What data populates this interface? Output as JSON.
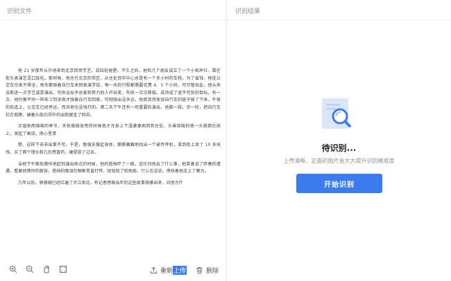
{
  "left_panel": {
    "title": "识别文件",
    "document": {
      "paragraphs": [
        "他 21 岁那年从外地来到北京拜师学艺，却四处碰壁。不久之后，他和几个朋友成立了一个小相声社，靠在街头表演艺混口饭吃。那时候，他住在北京的郊区，从住处到市中心总是有一个多小时的车程。为了省钱，他连公交车也舍不得坐，每天都骑着自行车来回表演学徒。每一天的行程都需要花费 4、5 个小时。可尽管如此，他从来没断进一次学艺或是演出。可命运似乎总爱和努力的人开玩笑，失败一次次降临，成功成了遥不可及的目标。有一次，他仍像平时一样练习到深夜才骑着自行车回家。可刚骑出没多远，他就突然发现自行车的链子掉了下来。午夜的街道上，公交车已经停运，而且他也没钱打的。第二天下午还有一场重要的演出，他脚一踩，牙一咬，把自行车扛在肩膀，硬着头皮向郊外的出租屋走了回去。",
        "正值秋雨绵绵的季节，天色微微发亮的时候他才浑身上下湿漉漉地回到住处，头晕目眩的他一头栽倒在床上，发起了高烧，他心里清",
        "楚，这样下去非出事不可。于是，勉强支撑起身体，颤颤巍巍地找出一个破传呼机，拿到街上卖了 10 多块钱，买了两个馒头和几包感冒药，硬是挺了过去。",
        "当他下午面色憔悴地赶到演出地点的时候，他的搭档吓了一跳，连忙问他出了什么事，他笑着说了昨晚的遭遇，看着他憔悴的面容，搭档的眼泪在眼眶里直打转，轻轻拍了拍他肩，什么也没说，搀扶着他走上了舞台。",
        "几年以后，郭德纲已经红遍了大江南北，有记者感慨当年的这些故事按摩出来，问他为什"
      ]
    },
    "toolbar": {
      "icons": [
        "zoom-in-icon",
        "zoom-out-icon",
        "rotate-icon",
        "fit-screen-icon"
      ],
      "reupload_prefix": "重新",
      "reupload_highlight": "上传",
      "delete_label": "删除"
    }
  },
  "right_panel": {
    "title": "识别结果",
    "status_icon": "document-search-icon",
    "status_title": "待识别...",
    "status_hint": "上传清晰、正面的图片会大大提升识别精准度",
    "start_button": "开始识别"
  },
  "colors": {
    "accent": "#3a7cf0",
    "muted_text": "#8a8f99",
    "divider": "#e6e8ec"
  }
}
